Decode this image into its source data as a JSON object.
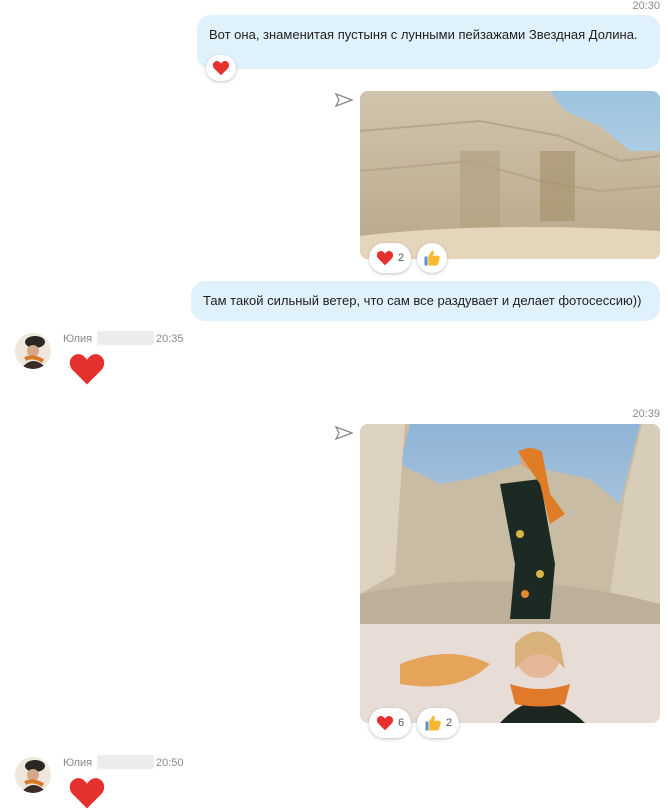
{
  "messages": [
    {
      "time": "20:30",
      "text": "Вот она, знаменитая пустыня с лунными пейзажами Звездная Долина."
    },
    {
      "reactions": [
        {
          "icon": "heart-icon",
          "count": "2"
        },
        {
          "icon": "thumbs-up-icon",
          "count": ""
        }
      ]
    },
    {
      "text": "Там такой сильный ветер, что сам все раздувает и делает фотосессию))"
    },
    {
      "sender": "Юлия",
      "time": "20:35"
    },
    {
      "time": "20:39",
      "reactions": [
        {
          "icon": "heart-icon",
          "count": "6"
        },
        {
          "icon": "thumbs-up-icon",
          "count": "2"
        }
      ]
    },
    {
      "sender": "Юлия",
      "time": "20:50"
    }
  ],
  "colors": {
    "bubble": "#dff1fb",
    "heart": "#e5312e",
    "thumb": "#f5b82e"
  }
}
